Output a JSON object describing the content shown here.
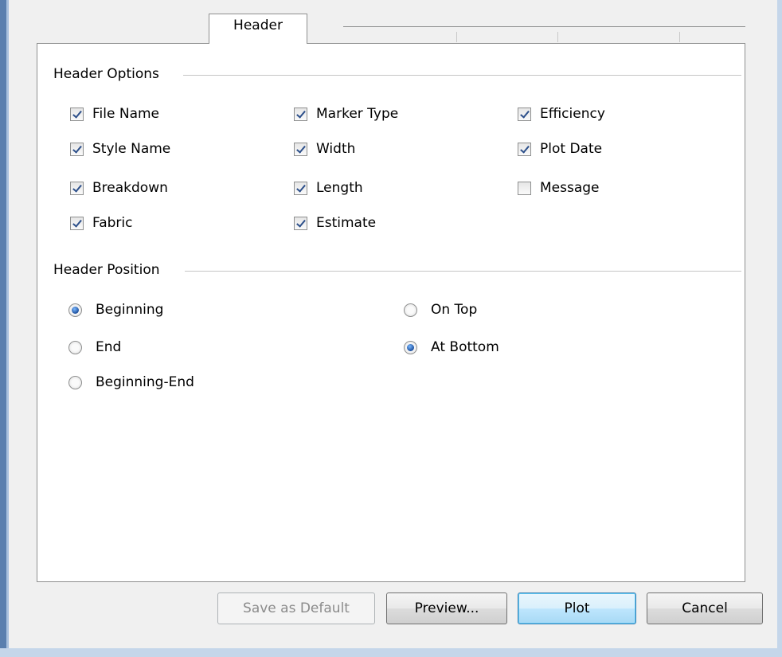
{
  "tabs": {
    "active_label": "Header"
  },
  "header_options": {
    "title": "Header Options",
    "items": [
      {
        "label": "File Name",
        "checked": true
      },
      {
        "label": "Marker Type",
        "checked": true
      },
      {
        "label": "Efficiency",
        "checked": true
      },
      {
        "label": "Style Name",
        "checked": true
      },
      {
        "label": "Width",
        "checked": true
      },
      {
        "label": "Plot Date",
        "checked": true
      },
      {
        "label": "Breakdown",
        "checked": true
      },
      {
        "label": "Length",
        "checked": true
      },
      {
        "label": "Message",
        "checked": false
      },
      {
        "label": "Fabric",
        "checked": true
      },
      {
        "label": "Estimate",
        "checked": true
      }
    ]
  },
  "header_position": {
    "title": "Header Position",
    "items": [
      {
        "label": "Beginning",
        "selected": true
      },
      {
        "label": "End",
        "selected": false
      },
      {
        "label": "Beginning-End",
        "selected": false
      },
      {
        "label": "On Top",
        "selected": false
      },
      {
        "label": "At Bottom",
        "selected": true
      }
    ]
  },
  "buttons": {
    "save_default": "Save as Default",
    "preview": "Preview...",
    "plot": "Plot",
    "cancel": "Cancel"
  },
  "colors": {
    "window_border": "#5a7fae",
    "default_button": "#bee6fd",
    "check_mark": "#2c4f8a"
  }
}
